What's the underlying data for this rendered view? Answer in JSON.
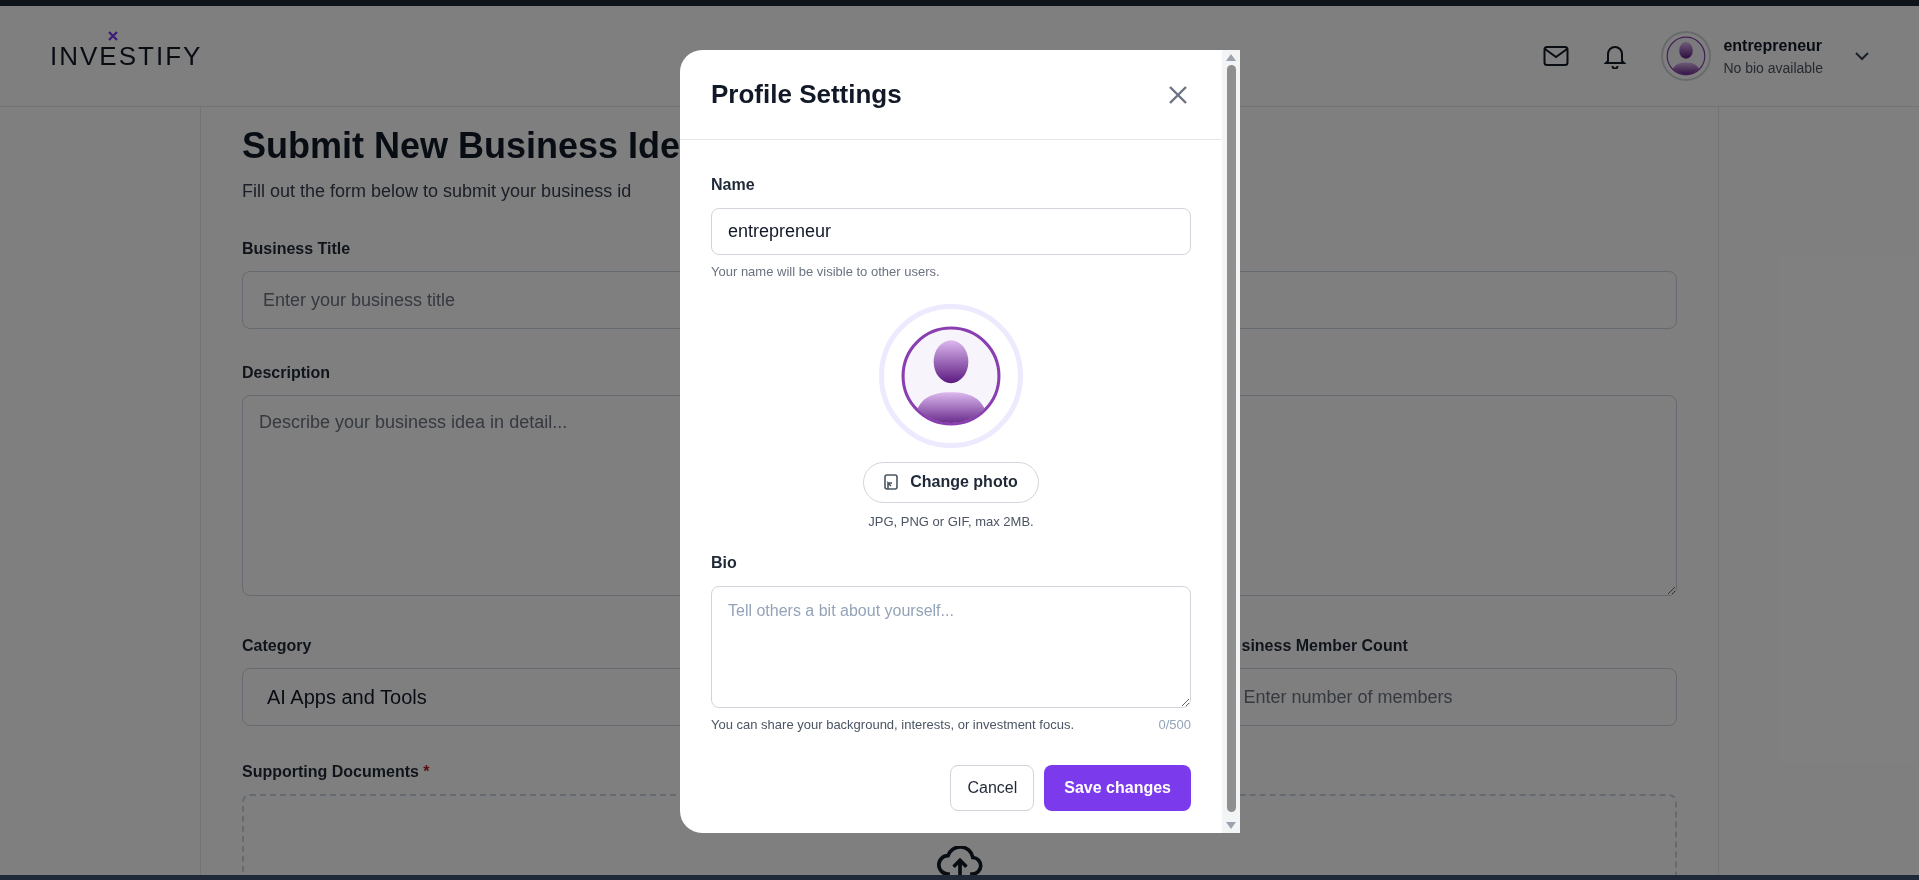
{
  "header": {
    "logo": "INVESTIFY",
    "user": {
      "name": "entrepreneur",
      "bio": "No bio available"
    }
  },
  "page": {
    "title": "Submit New Business Ide",
    "subtitle": "Fill out the form below to submit your business id",
    "fields": [
      {
        "kind": "input",
        "label": "Business Title",
        "placeholder": "Enter your business title"
      },
      {
        "kind": "textarea",
        "label": "Description",
        "placeholder": "Describe your business idea in detail..."
      }
    ],
    "category": {
      "label": "Category",
      "value": "AI Apps and Tools"
    },
    "member_count": {
      "label": "siness Member Count",
      "placeholder": "Enter number of members"
    },
    "documents": {
      "label": "Supporting Documents",
      "required_mark": "*"
    }
  },
  "modal": {
    "title": "Profile Settings",
    "name": {
      "label": "Name",
      "value": "entrepreneur",
      "hint": "Your name will be visible to other users."
    },
    "photo": {
      "button": "Change photo",
      "hint": "JPG, PNG or GIF, max 2MB."
    },
    "bio": {
      "label": "Bio",
      "placeholder": "Tell others a bit about yourself...",
      "hint": "You can share your background, interests, or investment focus.",
      "counter": "0/500"
    },
    "buttons": [
      {
        "kind": "secondary",
        "label": "Cancel"
      },
      {
        "kind": "primary",
        "label": "Save changes"
      }
    ]
  }
}
